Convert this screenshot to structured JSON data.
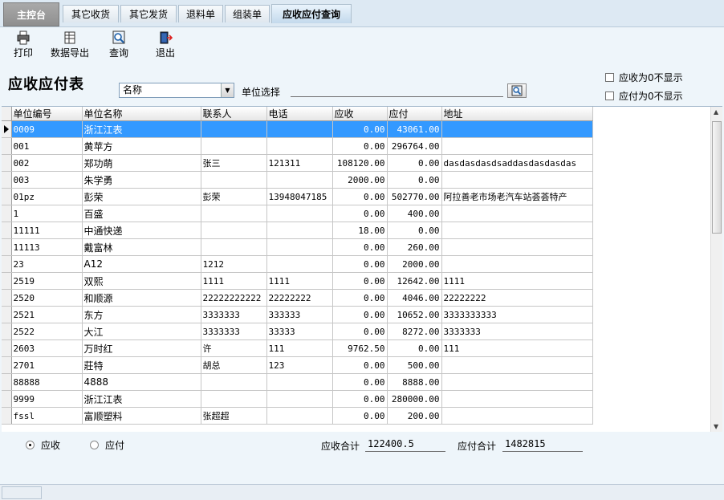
{
  "tabs": {
    "main": "主控台",
    "items": [
      {
        "label": "其它收货"
      },
      {
        "label": "其它发货"
      },
      {
        "label": "退料单"
      },
      {
        "label": "组装单"
      },
      {
        "label": "应收应付查询",
        "active": true
      }
    ]
  },
  "toolbar": {
    "print": "打印",
    "export": "数据导出",
    "query": "查询",
    "exit": "退出"
  },
  "header": {
    "title": "应收应付表",
    "combo_value": "名称",
    "unit_label": "单位选择",
    "unit_value": "",
    "hide_receivable_zero": "应收为0不显示",
    "hide_payable_zero": "应付为0不显示"
  },
  "grid": {
    "columns": [
      "单位编号",
      "单位名称",
      "联系人",
      "电话",
      "应收",
      "应付",
      "地址"
    ],
    "rows": [
      [
        "0009",
        "浙江江表",
        "",
        "",
        "0.00",
        "43061.00",
        ""
      ],
      [
        "001",
        "黄苹方",
        "",
        "",
        "0.00",
        "296764.00",
        ""
      ],
      [
        "002",
        "郑功萌",
        "张三",
        "121311",
        "108120.00",
        "0.00",
        "dasdasdasdsaddasdasdasdas"
      ],
      [
        "003",
        "朱学勇",
        "",
        "",
        "2000.00",
        "0.00",
        ""
      ],
      [
        "01pz",
        "彭荣",
        "彭荣",
        "13948047185",
        "0.00",
        "502770.00",
        "阿拉善老市场老汽车站荟荟特产"
      ],
      [
        "1",
        "百盛",
        "",
        "",
        "0.00",
        "400.00",
        ""
      ],
      [
        "11111",
        "中通快递",
        "",
        "",
        "18.00",
        "0.00",
        ""
      ],
      [
        "11113",
        "戴富林",
        "",
        "",
        "0.00",
        "260.00",
        ""
      ],
      [
        "23",
        "A12",
        "1212",
        "",
        "0.00",
        "2000.00",
        ""
      ],
      [
        "2519",
        "双熙",
        "1111",
        "1111",
        "0.00",
        "12642.00",
        "1111"
      ],
      [
        "2520",
        "和顺源",
        "22222222222",
        "22222222",
        "0.00",
        "4046.00",
        "22222222"
      ],
      [
        "2521",
        "东方",
        "3333333",
        "333333",
        "0.00",
        "10652.00",
        "3333333333"
      ],
      [
        "2522",
        "大江",
        "3333333",
        "33333",
        "0.00",
        "8272.00",
        "3333333"
      ],
      [
        "2603",
        "万时红",
        "许",
        "111",
        "9762.50",
        "0.00",
        "111"
      ],
      [
        "2701",
        "莊特",
        "胡总",
        "123",
        "0.00",
        "500.00",
        ""
      ],
      [
        "88888",
        "4888",
        "",
        "",
        "0.00",
        "8888.00",
        ""
      ],
      [
        "9999",
        "浙江江表",
        "",
        "",
        "0.00",
        "280000.00",
        ""
      ],
      [
        "fssl",
        "富顺塑料",
        "张超超",
        "",
        "0.00",
        "200.00",
        ""
      ]
    ],
    "selected_row": 0
  },
  "footer": {
    "radio_receivable": "应收",
    "radio_payable": "应付",
    "receivable_total_label": "应收合计",
    "receivable_total": "122400.5",
    "payable_total_label": "应付合计",
    "payable_total": "1482815"
  }
}
